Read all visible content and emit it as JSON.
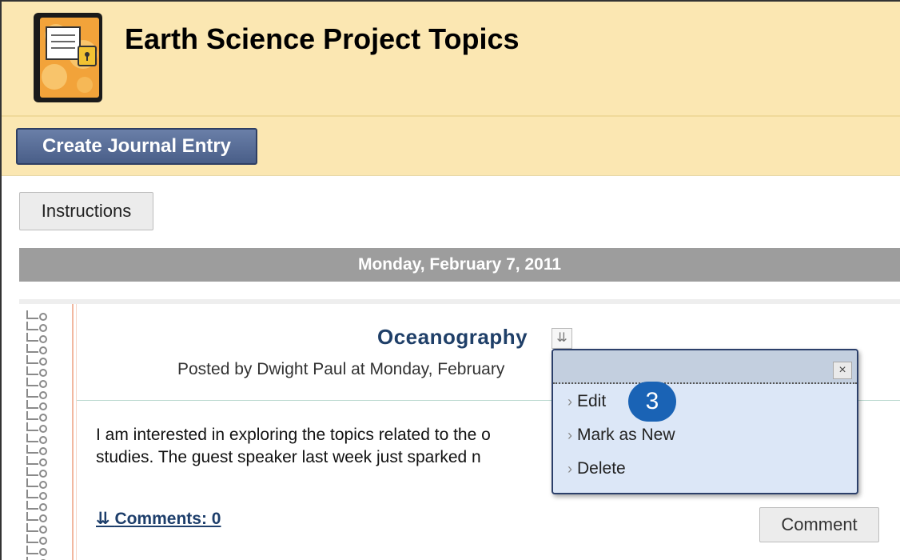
{
  "page": {
    "title": "Earth Science Project Topics"
  },
  "toolbar": {
    "create_label": "Create Journal Entry",
    "instructions_label": "Instructions"
  },
  "date_header": "Monday, February 7, 2011",
  "entry": {
    "title": "Oceanography",
    "posted_by": "Posted by Dwight Paul at Monday, February",
    "body_lines": [
      "I am interested in exploring the topics related to the o",
      "studies. The guest speaker last week just sparked n"
    ],
    "comments_label": "Comments: 0",
    "comment_button": "Comment"
  },
  "context_menu": {
    "items": [
      "Edit",
      "Mark as New",
      "Delete"
    ],
    "close_glyph": "×"
  },
  "step_badge": "3",
  "colors": {
    "header_bg": "#fbe7b2",
    "primary_button": "#495e88",
    "date_bar": "#9d9d9d",
    "link": "#1d3e6b",
    "badge": "#1a63b5",
    "menu_bg": "#dce7f7"
  },
  "icons": {
    "journal": "journal-notebook-icon",
    "options": "double-chevron-down-icon",
    "close": "close-icon",
    "menu_arrow": "chevron-right-icon",
    "spiral": "spiral-binding-icon"
  }
}
